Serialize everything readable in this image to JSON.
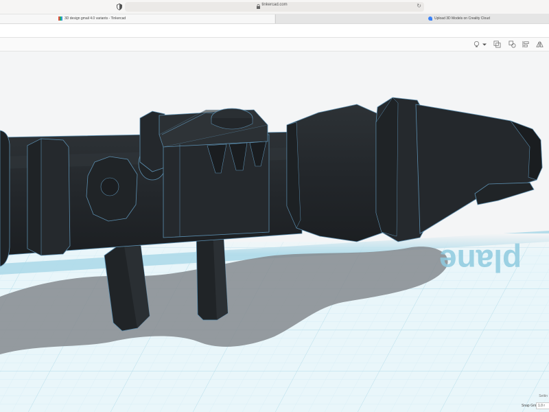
{
  "browser": {
    "url": "tinkercad.com",
    "tabs": [
      {
        "label": "3D design gmail 4.0 variants - Tinkercad"
      },
      {
        "label": "Upload 3D Models on Creality Cloud"
      }
    ]
  },
  "workplane": {
    "watermark": "plane"
  },
  "bottom_bar": {
    "settings_label": "Settin",
    "snap_grid_label": "Snap Grid",
    "snap_grid_value": "1.0 r"
  },
  "colors": {
    "model": "#23272b",
    "edge": "#5c8fb0",
    "grid_line": "#c6e6f0",
    "grid_background": "#e9f6fa"
  }
}
